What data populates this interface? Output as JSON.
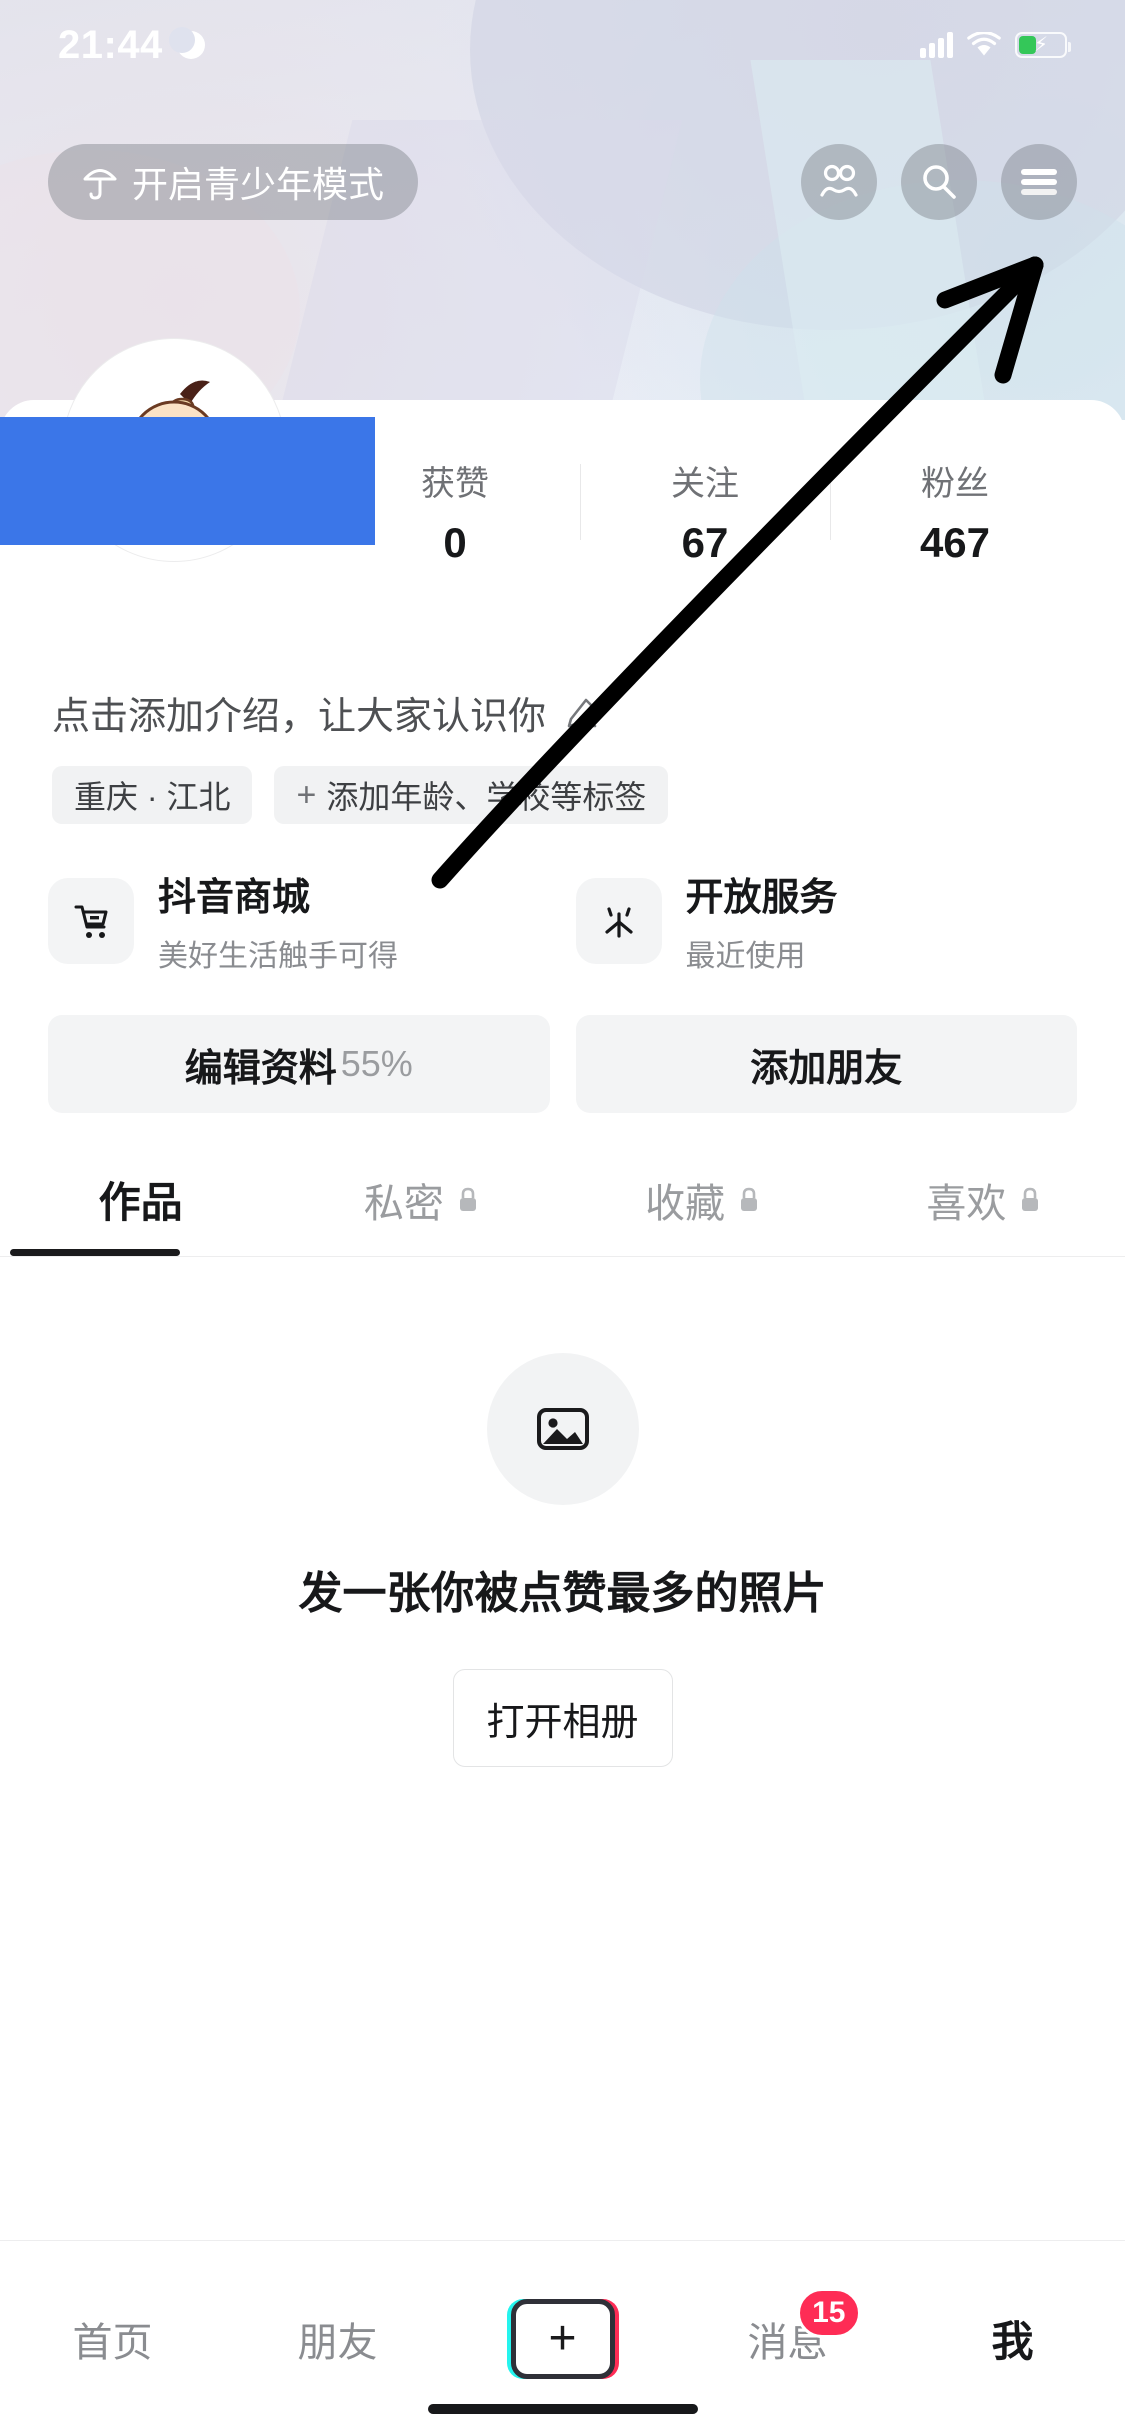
{
  "status_bar": {
    "time": "21:44",
    "moon_icon": "crescent-moon-icon",
    "signal_icon": "cellular-signal-icon",
    "wifi_icon": "wifi-icon",
    "battery_icon": "battery-charging-icon"
  },
  "header": {
    "teen_mode": {
      "icon": "umbrella-icon",
      "label": "开启青少年模式"
    },
    "buttons": [
      {
        "name": "friends-icon",
        "label": ""
      },
      {
        "name": "search-icon",
        "label": ""
      },
      {
        "name": "hamburger-menu-icon",
        "label": ""
      }
    ]
  },
  "profile": {
    "avatar_alt": "cartoon-baby-avatar",
    "username_redacted": true,
    "stats": [
      {
        "label": "获赞",
        "value": "0"
      },
      {
        "label": "关注",
        "value": "67"
      },
      {
        "label": "粉丝",
        "value": "467"
      }
    ],
    "bio": {
      "text": "点击添加介绍，让大家认识你",
      "edit_icon": "pencil-icon"
    },
    "tags": [
      {
        "text": "重庆 · 江北",
        "has_plus": false
      },
      {
        "text": "添加年龄、学校等标签",
        "has_plus": true,
        "plus": "+"
      }
    ]
  },
  "services": [
    {
      "icon": "shopping-cart-icon",
      "title": "抖音商城",
      "subtitle": "美好生活触手可得"
    },
    {
      "icon": "open-service-icon",
      "title": "开放服务",
      "subtitle": "最近使用"
    }
  ],
  "actions": [
    {
      "label": "编辑资料",
      "percent": "55%"
    },
    {
      "label": "添加朋友",
      "percent": ""
    }
  ],
  "tabs": [
    {
      "label": "作品",
      "locked": false,
      "active": true
    },
    {
      "label": "私密",
      "locked": true,
      "active": false
    },
    {
      "label": "收藏",
      "locked": true,
      "active": false
    },
    {
      "label": "喜欢",
      "locked": true,
      "active": false
    }
  ],
  "empty_state": {
    "icon": "photo-placeholder-icon",
    "title": "发一张你被点赞最多的照片",
    "button_label": "打开相册"
  },
  "bottom_nav": {
    "items": [
      {
        "label": "首页",
        "active": false,
        "badge": ""
      },
      {
        "label": "朋友",
        "active": false,
        "badge": ""
      },
      {
        "label": "",
        "active": false,
        "badge": "",
        "is_plus": true,
        "plus_glyph": "+"
      },
      {
        "label": "消息",
        "active": false,
        "badge": "15"
      },
      {
        "label": "我",
        "active": true,
        "badge": ""
      }
    ]
  },
  "annotation": {
    "type": "arrow",
    "points_to": "hamburger-menu-icon"
  },
  "colors": {
    "accent_red": "#fe2c55",
    "accent_cyan": "#25f4ee",
    "redaction_blue": "#3b76e8",
    "battery_green": "#34c759",
    "text_primary": "#17181a",
    "text_secondary": "#8a8c90"
  }
}
